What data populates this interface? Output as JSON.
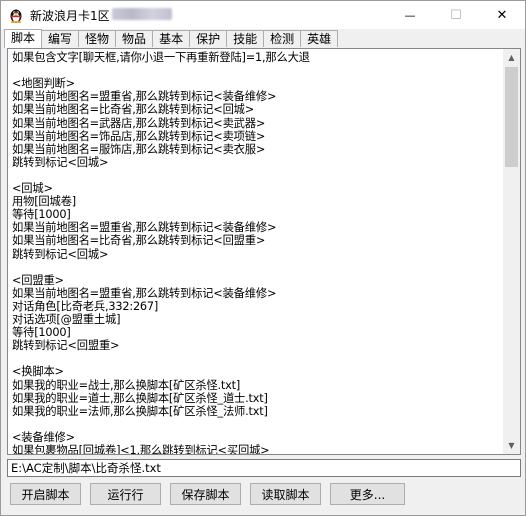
{
  "window": {
    "title": "新波浪月卡1区",
    "minimize_glyph": "—",
    "maximize_glyph": "☐",
    "close_glyph": "✕"
  },
  "tabs": [
    "脚本",
    "编写",
    "怪物",
    "物品",
    "基本",
    "保护",
    "技能",
    "检测",
    "英雄"
  ],
  "script_lines": [
    "如果包含文字[聊天框,请你小退一下再重新登陆]=1,那么大退",
    "",
    "<地图判断>",
    "如果当前地图名=盟重省,那么跳转到标记<装备维修>",
    "如果当前地图名=比奇省,那么跳转到标记<回城>",
    "如果当前地图名=武器店,那么跳转到标记<卖武器>",
    "如果当前地图名=饰品店,那么跳转到标记<卖项链>",
    "如果当前地图名=服饰店,那么跳转到标记<卖衣服>",
    "跳转到标记<回城>",
    "",
    "<回城>",
    "用物[回城卷]",
    "等待[1000]",
    "如果当前地图名=盟重省,那么跳转到标记<装备维修>",
    "如果当前地图名=比奇省,那么跳转到标记<回盟重>",
    "跳转到标记<回城>",
    "",
    "<回盟重>",
    "如果当前地图名=盟重省,那么跳转到标记<装备维修>",
    "对话角色[比奇老兵,332:267]",
    "对话选项[@盟重土城]",
    "等待[1000]",
    "跳转到标记<回盟重>",
    "",
    "<换脚本>",
    "如果我的职业=战士,那么换脚本[矿区杀怪.txt]",
    "如果我的职业=道士,那么换脚本[矿区杀怪_道士.txt]",
    "如果我的职业=法师,那么换脚本[矿区杀怪_法师.txt]",
    "",
    "<装备维修>",
    "如果包裹物品[回城卷]<1,那么跳转到标记<买回城>"
  ],
  "script_path": "E:\\AC定制\\脚本\\比奇杀怪.txt",
  "buttons": {
    "start": "开启脚本",
    "run_line": "运行行",
    "save": "保存脚本",
    "load": "读取脚本",
    "more": "更多..."
  },
  "scrollbar": {
    "up_glyph": "▲",
    "down_glyph": "▼"
  }
}
